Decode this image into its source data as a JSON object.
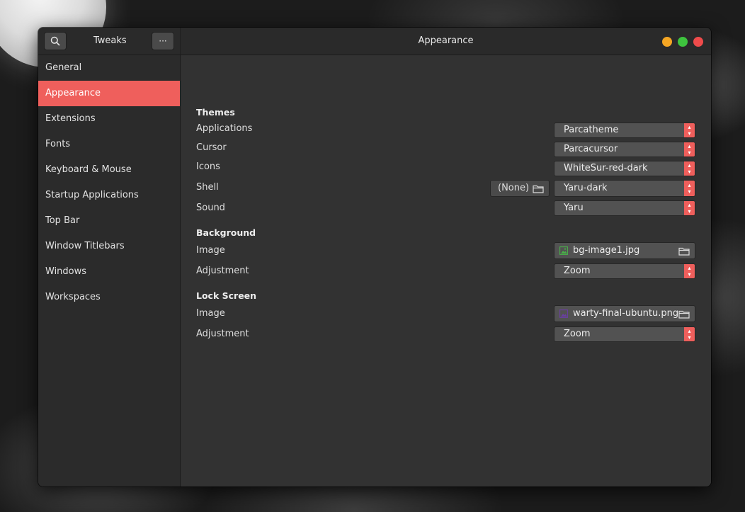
{
  "window": {
    "app_title": "Tweaks",
    "page_title": "Appearance",
    "controls": {
      "minimize_color": "#f5a623",
      "maximize_color": "#3ec43e",
      "close_color": "#ef4b4b"
    }
  },
  "titlebar": {
    "search_icon": "search-icon",
    "menu_icon": "more-horizontal-icon",
    "menu_label": "···"
  },
  "accent_color": "#ef5f5c",
  "sidebar": {
    "items": [
      {
        "label": "General"
      },
      {
        "label": "Appearance",
        "active": true
      },
      {
        "label": "Extensions"
      },
      {
        "label": "Fonts"
      },
      {
        "label": "Keyboard & Mouse"
      },
      {
        "label": "Startup Applications"
      },
      {
        "label": "Top Bar"
      },
      {
        "label": "Window Titlebars"
      },
      {
        "label": "Windows"
      },
      {
        "label": "Workspaces"
      }
    ]
  },
  "themes": {
    "heading": "Themes",
    "applications": {
      "label": "Applications",
      "value": "Parcatheme"
    },
    "cursor": {
      "label": "Cursor",
      "value": "Parcacursor"
    },
    "icons": {
      "label": "Icons",
      "value": "WhiteSur-red-dark"
    },
    "shell": {
      "label": "Shell",
      "file_value": "(None)",
      "value": "Yaru-dark"
    },
    "sound": {
      "label": "Sound",
      "value": "Yaru"
    }
  },
  "background": {
    "heading": "Background",
    "image": {
      "label": "Image",
      "value": "bg-image1.jpg"
    },
    "adjustment": {
      "label": "Adjustment",
      "value": "Zoom"
    }
  },
  "lock_screen": {
    "heading": "Lock Screen",
    "image": {
      "label": "Image",
      "value": "warty-final-ubuntu.png"
    },
    "adjustment": {
      "label": "Adjustment",
      "value": "Zoom"
    }
  }
}
